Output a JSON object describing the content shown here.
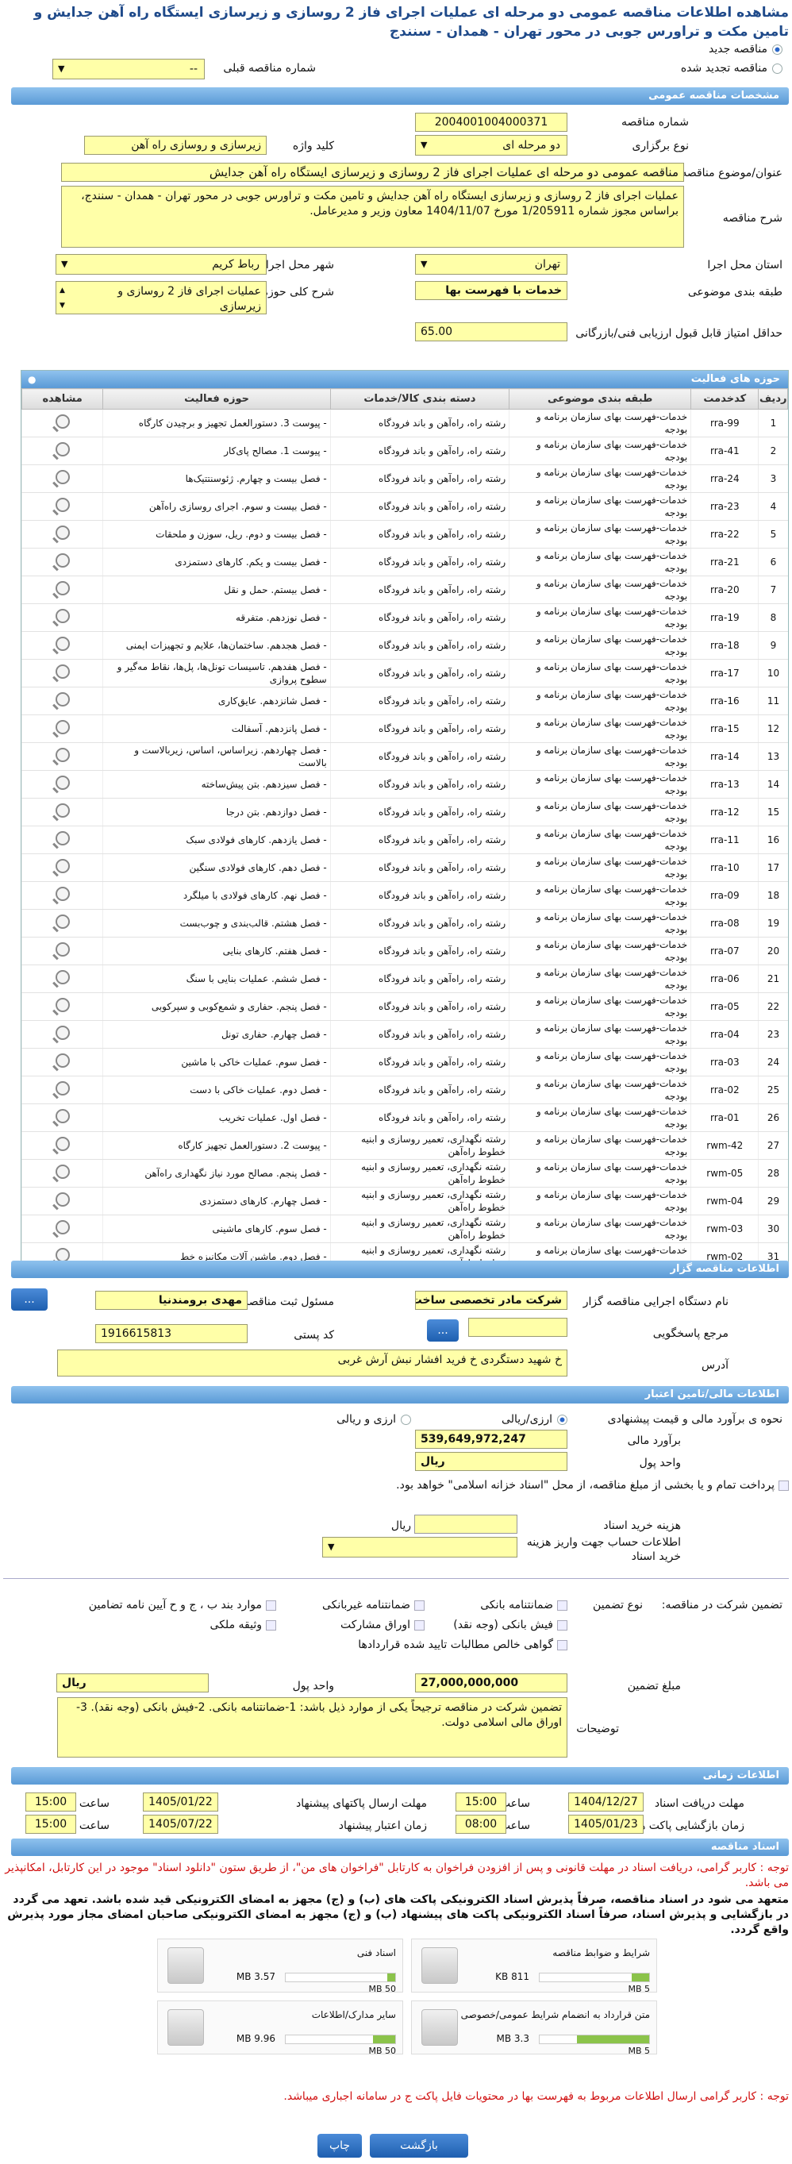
{
  "page_title": "مشاهده اطلاعات مناقصه عمومی دو مرحله ای عملیات اجرای فاز 2 روسازی و زیرسازی ایستگاه راه آهن جدایش و تامین مکت و تراورس جوبی در محور تهران - همدان - سنندج",
  "top": {
    "new_tender": "مناقصه جدید",
    "renewed_tender": "مناقصه تجدید شده",
    "prev_number_label": "شماره مناقصه قبلی",
    "prev_number_value": "--"
  },
  "general": {
    "header": "مشخصات مناقصه عمومی",
    "number_label": "شماره مناقصه",
    "number_value": "2004001004000371",
    "type_label": "نوع برگزاری",
    "type_value": "دو مرحله ای",
    "keyword_label": "کلید واژه",
    "keyword_value": "زیرسازی و روسازی راه آهن",
    "subject_label": "عنوان/موضوع مناقصه",
    "subject_value": "مناقصه عمومی دو مرحله ای عملیات اجرای فاز 2 روسازی و زیرسازی ایستگاه راه آهن جدایش",
    "desc_label": "شرح مناقصه",
    "desc_value": "عملیات اجرای فاز 2 روسازی و زیرسازی ایستگاه راه آهن جدایش و تامین مکت و تراورس جوبی در محور تهران - همدان - سنندج، براساس مجوز شماره 1/205911 مورخ 1404/11/07 معاون وزیر و مدیرعامل.",
    "province_label": "استان محل اجرا",
    "province_value": "تهران",
    "city_label": "شهر محل اجرا",
    "city_value": "رباط کریم",
    "category_label": "طبقه بندی موضوعی",
    "category_value": "خدمات با فهرست بها",
    "scope_label": "شرح کلی حوزه فعالیت",
    "scope_value": "عملیات اجرای فاز 2 روسازی و زیرسازی",
    "min_score_label": "حداقل امتیاز قابل قبول ارزیابی فنی/بازرگانی",
    "min_score_value": "65.00"
  },
  "activity": {
    "header": "حوزه های فعالیت",
    "cols": [
      "ردیف",
      "کدخدمت",
      "طبقه بندی موضوعی",
      "دسته بندی کالا/خدمات",
      "حوزه فعالیت",
      "مشاهده"
    ],
    "rows": [
      [
        "1",
        "rra-99",
        "خدمات-فهرست بهای سازمان برنامه و بودجه",
        "رشته راه، راه‌آهن و باند فرودگاه",
        "- پیوست 3. دستورالعمل تجهیز و برچیدن کارگاه"
      ],
      [
        "2",
        "rra-41",
        "خدمات-فهرست بهای سازمان برنامه و بودجه",
        "رشته راه، راه‌آهن و باند فرودگاه",
        "- پیوست 1. مصالح پای‌کار"
      ],
      [
        "3",
        "rra-24",
        "خدمات-فهرست بهای سازمان برنامه و بودجه",
        "رشته راه، راه‌آهن و باند فرودگاه",
        "- فصل بیست و چهارم. ژئوسنتتیک‌ها"
      ],
      [
        "4",
        "rra-23",
        "خدمات-فهرست بهای سازمان برنامه و بودجه",
        "رشته راه، راه‌آهن و باند فرودگاه",
        "- فصل بیست و سوم. اجرای روسازی راه‌آهن"
      ],
      [
        "5",
        "rra-22",
        "خدمات-فهرست بهای سازمان برنامه و بودجه",
        "رشته راه، راه‌آهن و باند فرودگاه",
        "- فصل بیست و دوم. ریل، سوزن و ملحقات"
      ],
      [
        "6",
        "rra-21",
        "خدمات-فهرست بهای سازمان برنامه و بودجه",
        "رشته راه، راه‌آهن و باند فرودگاه",
        "- فصل بیست و یکم. کارهای دستمزدی"
      ],
      [
        "7",
        "rra-20",
        "خدمات-فهرست بهای سازمان برنامه و بودجه",
        "رشته راه، راه‌آهن و باند فرودگاه",
        "- فصل بیستم. حمل و نقل"
      ],
      [
        "8",
        "rra-19",
        "خدمات-فهرست بهای سازمان برنامه و بودجه",
        "رشته راه، راه‌آهن و باند فرودگاه",
        "- فصل نوزدهم. متفرقه"
      ],
      [
        "9",
        "rra-18",
        "خدمات-فهرست بهای سازمان برنامه و بودجه",
        "رشته راه، راه‌آهن و باند فرودگاه",
        "- فصل هجدهم. ساختمان‌ها، علایم و تجهیزات ایمنی"
      ],
      [
        "10",
        "rra-17",
        "خدمات-فهرست بهای سازمان برنامه و بودجه",
        "رشته راه، راه‌آهن و باند فرودگاه",
        "- فصل هفدهم. تاسیسات تونل‌ها، پل‌ها، نقاط مه‌گیر و سطوح پروازی"
      ],
      [
        "11",
        "rra-16",
        "خدمات-فهرست بهای سازمان برنامه و بودجه",
        "رشته راه، راه‌آهن و باند فرودگاه",
        "- فصل شانزدهم. عایق‌کاری"
      ],
      [
        "12",
        "rra-15",
        "خدمات-فهرست بهای سازمان برنامه و بودجه",
        "رشته راه، راه‌آهن و باند فرودگاه",
        "- فصل پانزدهم. آسفالت"
      ],
      [
        "13",
        "rra-14",
        "خدمات-فهرست بهای سازمان برنامه و بودجه",
        "رشته راه، راه‌آهن و باند فرودگاه",
        "- فصل چهاردهم. زیراساس، اساس، زیربالاست و بالاست"
      ],
      [
        "14",
        "rra-13",
        "خدمات-فهرست بهای سازمان برنامه و بودجه",
        "رشته راه، راه‌آهن و باند فرودگاه",
        "- فصل سیزدهم. بتن پیش‌ساخته"
      ],
      [
        "15",
        "rra-12",
        "خدمات-فهرست بهای سازمان برنامه و بودجه",
        "رشته راه، راه‌آهن و باند فرودگاه",
        "- فصل دوازدهم. بتن درجا"
      ],
      [
        "16",
        "rra-11",
        "خدمات-فهرست بهای سازمان برنامه و بودجه",
        "رشته راه، راه‌آهن و باند فرودگاه",
        "- فصل یازدهم. کارهای فولادی سبک"
      ],
      [
        "17",
        "rra-10",
        "خدمات-فهرست بهای سازمان برنامه و بودجه",
        "رشته راه، راه‌آهن و باند فرودگاه",
        "- فصل دهم. کارهای فولادی سنگین"
      ],
      [
        "18",
        "rra-09",
        "خدمات-فهرست بهای سازمان برنامه و بودجه",
        "رشته راه، راه‌آهن و باند فرودگاه",
        "- فصل نهم. کارهای فولادی با میلگرد"
      ],
      [
        "19",
        "rra-08",
        "خدمات-فهرست بهای سازمان برنامه و بودجه",
        "رشته راه، راه‌آهن و باند فرودگاه",
        "- فصل هشتم. قالب‌بندی و چوب‌بست"
      ],
      [
        "20",
        "rra-07",
        "خدمات-فهرست بهای سازمان برنامه و بودجه",
        "رشته راه، راه‌آهن و باند فرودگاه",
        "- فصل هفتم. کارهای بنایی"
      ],
      [
        "21",
        "rra-06",
        "خدمات-فهرست بهای سازمان برنامه و بودجه",
        "رشته راه، راه‌آهن و باند فرودگاه",
        "- فصل ششم. عملیات بنایی با سنگ"
      ],
      [
        "22",
        "rra-05",
        "خدمات-فهرست بهای سازمان برنامه و بودجه",
        "رشته راه، راه‌آهن و باند فرودگاه",
        "- فصل پنجم. حفاری و شمع‌کوبی و سپرکوبی"
      ],
      [
        "23",
        "rra-04",
        "خدمات-فهرست بهای سازمان برنامه و بودجه",
        "رشته راه، راه‌آهن و باند فرودگاه",
        "- فصل چهارم. حفاری تونل"
      ],
      [
        "24",
        "rra-03",
        "خدمات-فهرست بهای سازمان برنامه و بودجه",
        "رشته راه، راه‌آهن و باند فرودگاه",
        "- فصل سوم. عملیات خاکی با ماشین"
      ],
      [
        "25",
        "rra-02",
        "خدمات-فهرست بهای سازمان برنامه و بودجه",
        "رشته راه، راه‌آهن و باند فرودگاه",
        "- فصل دوم. عملیات خاکی با دست"
      ],
      [
        "26",
        "rra-01",
        "خدمات-فهرست بهای سازمان برنامه و بودجه",
        "رشته راه، راه‌آهن و باند فرودگاه",
        "- فصل اول. عملیات تخریب"
      ],
      [
        "27",
        "rwm-42",
        "خدمات-فهرست بهای سازمان برنامه و بودجه",
        "رشته نگهداری، تعمیر روسازی و ابنیه خطوط راه‌آهن",
        "- پیوست 2. دستورالعمل تجهیز کارگاه"
      ],
      [
        "28",
        "rwm-05",
        "خدمات-فهرست بهای سازمان برنامه و بودجه",
        "رشته نگهداری، تعمیر روسازی و ابنیه خطوط راه‌آهن",
        "- فصل پنجم. مصالح مورد نیاز نگهداری راه‌آهن"
      ],
      [
        "29",
        "rwm-04",
        "خدمات-فهرست بهای سازمان برنامه و بودجه",
        "رشته نگهداری، تعمیر روسازی و ابنیه خطوط راه‌آهن",
        "- فصل چهارم. کارهای دستمزدی"
      ],
      [
        "30",
        "rwm-03",
        "خدمات-فهرست بهای سازمان برنامه و بودجه",
        "رشته نگهداری، تعمیر روسازی و ابنیه خطوط راه‌آهن",
        "- فصل سوم. کارهای ماشینی"
      ],
      [
        "31",
        "rwm-02",
        "خدمات-فهرست بهای سازمان برنامه و بودجه",
        "رشته نگهداری، تعمیر روسازی و ابنیه خطوط راه‌آهن",
        "- فصل دوم. ماشین آلات مکانیزه خط"
      ]
    ]
  },
  "organizer": {
    "header": "اطلاعات مناقصه گزار",
    "org_label": "نام دستگاه اجرایی مناقصه گزار",
    "org_value": "شرکت مادر تخصصی ساخت",
    "resp_label": "مسئول ثبت مناقصه",
    "resp_value": "مهدی برومندنیا",
    "ref_label": "مرجع پاسخگویی",
    "postal_label": "کد پستی",
    "postal_value": "1916615813",
    "address_label": "آدرس",
    "address_value": "خ شهید دستگردی خ فرید افشار نبش آرش غربی",
    "btn_dots": "..."
  },
  "finance": {
    "header": "اطلاعات مالی/تامین اعتبار",
    "estimate_label": "نحوه ی برآورد مالی و قیمت پیشنهادی",
    "opt_rial": "ارزی/ریالی",
    "opt_fx": "ارزی و ریالی",
    "estimate_amount_label": "برآورد مالی",
    "estimate_amount": "539,649,972,247",
    "currency_label": "واحد پول",
    "currency": "ریال",
    "payment_text": "پرداخت تمام و یا بخشی از مبلغ مناقصه، از محل \"اسناد خزانه اسلامی\" خواهد بود.",
    "doc_cost_label": "هزینه خرید اسناد",
    "doc_cost_unit": "ریال",
    "account_label": "اطلاعات حساب جهت واریز هزینه خرید اسناد"
  },
  "guarantee": {
    "participation_label": "تضمین شرکت در مناقصه:",
    "type_label": "نوع تضمین",
    "options": [
      "ضمانتنامه بانکی",
      "ضمانتنامه غیربانکی",
      "موارد بند ب ، ج و ح آیین نامه تضامین",
      "فیش بانکی (وجه نقد)",
      "اوراق مشارکت",
      "وثیقه ملکی",
      "گواهی خالص مطالبات تایید شده قراردادها"
    ],
    "amount_label": "مبلغ تضمین",
    "amount": "27,000,000,000",
    "currency_label": "واحد پول",
    "currency": "ریال",
    "notes_label": "توضیحات",
    "notes": "تضمین شرکت در مناقصه ترجیحاً یکی از موارد ذیل باشد: 1-ضمانتنامه بانکی. 2-فیش بانکی (وجه نقد). 3-اوراق مالی اسلامی دولت."
  },
  "timing": {
    "header": "اطلاعات زمانی",
    "doc_deadline_label": "مهلت دریافت اسناد",
    "doc_deadline_date": "1404/12/27",
    "doc_deadline_time": "15:00",
    "bid_deadline_label": "مهلت ارسال پاکتهای پیشنهاد",
    "bid_deadline_date": "1405/01/22",
    "bid_deadline_time": "15:00",
    "opening_label": "زمان بازگشایی پاکت ها",
    "opening_date": "1405/01/23",
    "opening_time": "08:00",
    "validity_label": "زمان اعتبار پیشنهاد",
    "validity_date": "1405/07/22",
    "validity_time": "15:00",
    "time_label": "ساعت"
  },
  "docs": {
    "header": "اسناد مناقصه",
    "note1": "توجه : کاربر گرامی، دریافت اسناد در مهلت قانونی و پس از افزودن فراخوان به کارتابل \"فراخوان های من\"، از طریق ستون \"دانلود اسناد\" موجود در این کارتابل، امکانپذیر می باشد.",
    "note2": "متعهد می شود در اسناد مناقصه، صرفاً پذیرش اسناد الکترونیکی پاکت های (ب) و (ج) مجهز به امضای الکترونیکی قید شده باشد. تعهد می گردد در بازگشایی و پذیرش اسناد، صرفاً اسناد الکترونیکی پاکت های پیشنهاد (ب) و (ج) مجهز به امضای الکترونیکی صاحبان امضای مجاز مورد پذیرش واقع گردد.",
    "files": [
      {
        "name": "شرایط و ضوابط مناقصه",
        "size": "811 KB",
        "max": "5 MB",
        "fill": 0.16
      },
      {
        "name": "اسناد فنی",
        "size": "3.57 MB",
        "max": "50 MB",
        "fill": 0.07
      },
      {
        "name": "متن قرارداد به انضمام شرایط عمومی/خصوصی",
        "size": "3.3 MB",
        "max": "5 MB",
        "fill": 0.66
      },
      {
        "name": "سایر مدارک/اطلاعات",
        "size": "9.96 MB",
        "max": "50 MB",
        "fill": 0.2
      }
    ],
    "note3": "توجه : کاربر گرامی ارسال اطلاعات مربوط به فهرست بها در محتویات فایل پاکت ج در سامانه اجباری میباشد."
  },
  "buttons": {
    "print": "چاپ",
    "back": "بازگشت"
  }
}
